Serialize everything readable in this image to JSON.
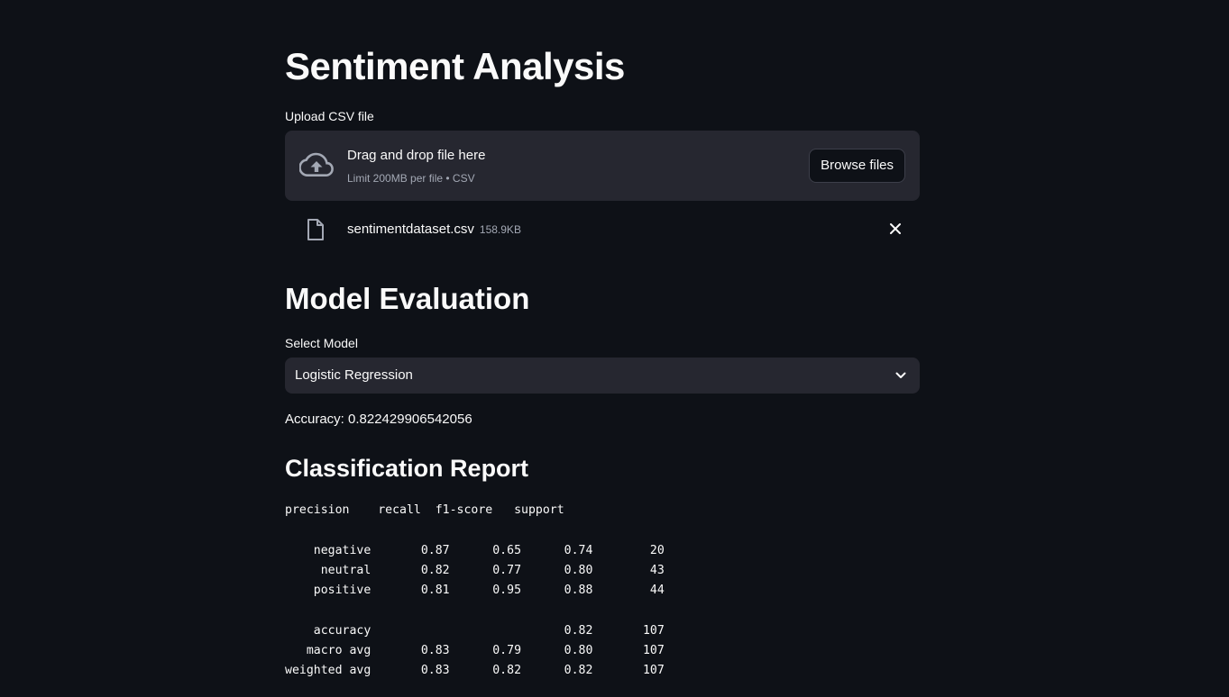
{
  "page": {
    "title": "Sentiment Analysis"
  },
  "uploader": {
    "label": "Upload CSV file",
    "drop_title": "Drag and drop file here",
    "drop_subtitle": "Limit 200MB per file • CSV",
    "browse_label": "Browse files",
    "icon": "cloud-upload-icon"
  },
  "uploaded_file": {
    "name": "sentimentdataset.csv",
    "size": "158.9KB",
    "icon": "file-icon"
  },
  "evaluation": {
    "heading": "Model Evaluation",
    "select_label": "Select Model",
    "selected_model": "Logistic Regression",
    "accuracy_text": "Accuracy: 0.822429906542056"
  },
  "report": {
    "heading": "Classification Report",
    "text": "precision    recall  f1-score   support\n\n    negative       0.87      0.65      0.74        20\n     neutral       0.82      0.77      0.80        43\n    positive       0.81      0.95      0.88        44\n\n    accuracy                           0.82       107\n   macro avg       0.83      0.79      0.80       107\nweighted avg       0.83      0.82      0.82       107"
  }
}
